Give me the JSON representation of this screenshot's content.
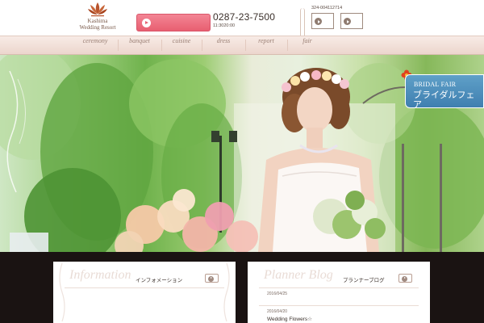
{
  "header": {
    "logo_line1": "Kashima",
    "logo_line2": "Wedding Resort",
    "phone": "0287-23-7500",
    "hours": "11:3020:00",
    "reg_code": "324-004112714"
  },
  "nav": {
    "items": [
      {
        "label": "ceremony"
      },
      {
        "label": "banquet"
      },
      {
        "label": "cuisine"
      },
      {
        "label": "dress"
      },
      {
        "label": "report"
      },
      {
        "label": "fair"
      }
    ]
  },
  "hero": {
    "fair_en": "BRIDAL FAIR",
    "fair_ja": "ブライダルフェア"
  },
  "info_panel": {
    "script_title": "Information",
    "ja_title": "インフォメーション"
  },
  "blog_panel": {
    "script_title": "Planner Blog",
    "ja_title": "プランナーブログ",
    "posts": [
      {
        "date": "2016/04/25",
        "title": ""
      },
      {
        "date": "2016/04/20",
        "title": "Wedding Flowers☆"
      }
    ]
  },
  "colors": {
    "accent_pink": "#e85f71",
    "fair_blue": "#3f7fb0",
    "nav_bg": "#f3e2db"
  }
}
